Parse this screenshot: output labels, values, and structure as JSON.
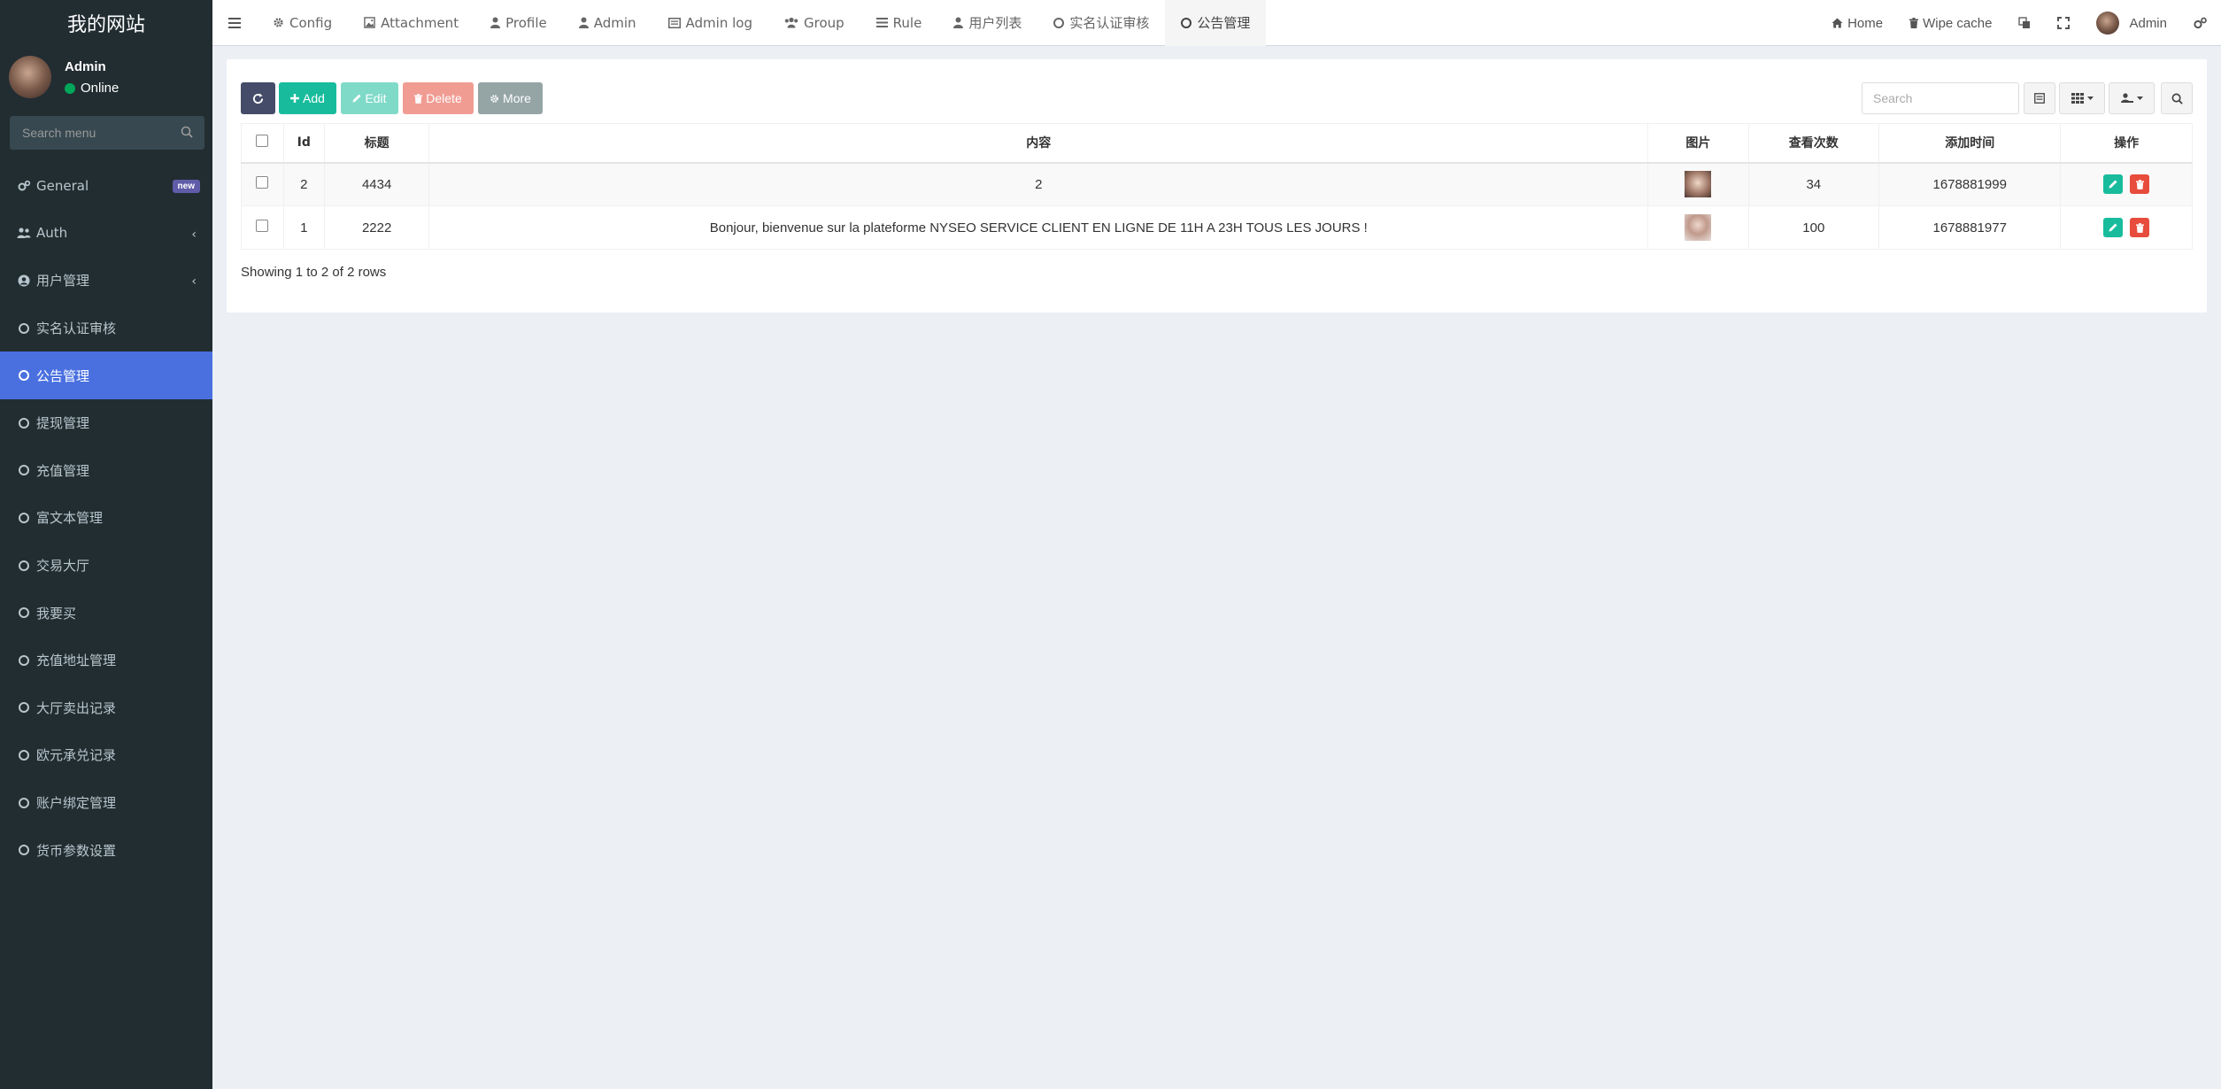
{
  "site": {
    "title": "我的网站"
  },
  "user": {
    "name": "Admin",
    "status": "Online"
  },
  "search_menu": {
    "placeholder": "Search menu"
  },
  "menu": [
    {
      "label": "General",
      "icon": "cogs-icon",
      "badge": "new"
    },
    {
      "label": "Auth",
      "icon": "users-icon",
      "chevron": "‹"
    },
    {
      "label": "用户管理",
      "icon": "user-circle-icon",
      "chevron": "‹"
    },
    {
      "label": "实名认证审核",
      "icon": "circle-icon"
    },
    {
      "label": "公告管理",
      "icon": "circle-icon",
      "active": true
    },
    {
      "label": "提现管理",
      "icon": "circle-icon"
    },
    {
      "label": "充值管理",
      "icon": "circle-icon"
    },
    {
      "label": "富文本管理",
      "icon": "circle-icon"
    },
    {
      "label": "交易大厅",
      "icon": "circle-icon"
    },
    {
      "label": "我要买",
      "icon": "circle-icon"
    },
    {
      "label": "充值地址管理",
      "icon": "circle-icon"
    },
    {
      "label": "大厅卖出记录",
      "icon": "circle-icon"
    },
    {
      "label": "欧元承兑记录",
      "icon": "circle-icon"
    },
    {
      "label": "账户绑定管理",
      "icon": "circle-icon"
    },
    {
      "label": "货币参数设置",
      "icon": "circle-icon"
    }
  ],
  "tabs": [
    {
      "label": "Config",
      "icon": "gear-icon"
    },
    {
      "label": "Attachment",
      "icon": "image-icon"
    },
    {
      "label": "Profile",
      "icon": "user-icon"
    },
    {
      "label": "Admin",
      "icon": "user-icon"
    },
    {
      "label": "Admin log",
      "icon": "list-alt-icon"
    },
    {
      "label": "Group",
      "icon": "group-icon"
    },
    {
      "label": "Rule",
      "icon": "bars-icon"
    },
    {
      "label": "用户列表",
      "icon": "user-icon"
    },
    {
      "label": "实名认证审核",
      "icon": "circle-icon"
    },
    {
      "label": "公告管理",
      "icon": "circle-icon",
      "active": true
    }
  ],
  "topright": {
    "home": "Home",
    "wipe_cache": "Wipe cache",
    "admin": "Admin"
  },
  "toolbar": {
    "add": "Add",
    "edit": "Edit",
    "delete": "Delete",
    "more": "More",
    "search_placeholder": "Search"
  },
  "table": {
    "columns": [
      "Id",
      "标题",
      "内容",
      "图片",
      "查看次数",
      "添加时间",
      "操作"
    ],
    "rows": [
      {
        "id": "2",
        "title": "4434",
        "content": "2",
        "views": "34",
        "time": "1678881999"
      },
      {
        "id": "1",
        "title": "2222",
        "content": "Bonjour, bienvenue sur la plateforme NYSEO SERVICE CLIENT EN LIGNE DE 11H A 23H TOUS LES JOURS !",
        "views": "100",
        "time": "1678881977"
      }
    ]
  },
  "pagination": {
    "info": "Showing 1 to 2 of 2 rows"
  },
  "colors": {
    "sidebar": "#222d32",
    "active": "#4a70e0",
    "success": "#18bc9c",
    "danger": "#e74c3c",
    "dark": "#444c69",
    "gray": "#95a5a6"
  }
}
